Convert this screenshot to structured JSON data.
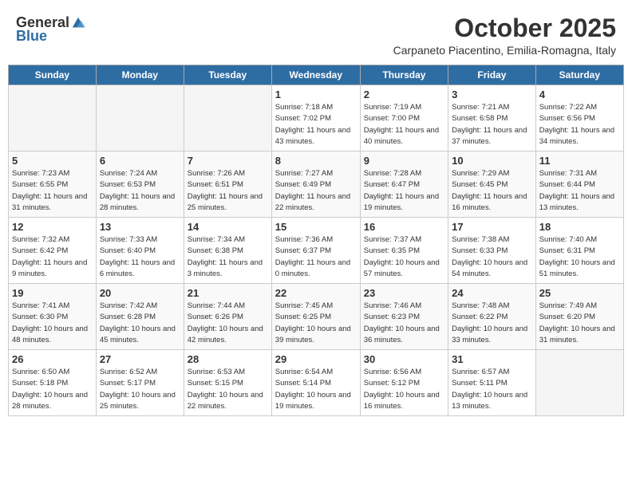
{
  "header": {
    "logo_general": "General",
    "logo_blue": "Blue",
    "month_title": "October 2025",
    "subtitle": "Carpaneto Piacentino, Emilia-Romagna, Italy"
  },
  "days_of_week": [
    "Sunday",
    "Monday",
    "Tuesday",
    "Wednesday",
    "Thursday",
    "Friday",
    "Saturday"
  ],
  "weeks": [
    [
      {
        "day": "",
        "info": ""
      },
      {
        "day": "",
        "info": ""
      },
      {
        "day": "",
        "info": ""
      },
      {
        "day": "1",
        "info": "Sunrise: 7:18 AM\nSunset: 7:02 PM\nDaylight: 11 hours and 43 minutes."
      },
      {
        "day": "2",
        "info": "Sunrise: 7:19 AM\nSunset: 7:00 PM\nDaylight: 11 hours and 40 minutes."
      },
      {
        "day": "3",
        "info": "Sunrise: 7:21 AM\nSunset: 6:58 PM\nDaylight: 11 hours and 37 minutes."
      },
      {
        "day": "4",
        "info": "Sunrise: 7:22 AM\nSunset: 6:56 PM\nDaylight: 11 hours and 34 minutes."
      }
    ],
    [
      {
        "day": "5",
        "info": "Sunrise: 7:23 AM\nSunset: 6:55 PM\nDaylight: 11 hours and 31 minutes."
      },
      {
        "day": "6",
        "info": "Sunrise: 7:24 AM\nSunset: 6:53 PM\nDaylight: 11 hours and 28 minutes."
      },
      {
        "day": "7",
        "info": "Sunrise: 7:26 AM\nSunset: 6:51 PM\nDaylight: 11 hours and 25 minutes."
      },
      {
        "day": "8",
        "info": "Sunrise: 7:27 AM\nSunset: 6:49 PM\nDaylight: 11 hours and 22 minutes."
      },
      {
        "day": "9",
        "info": "Sunrise: 7:28 AM\nSunset: 6:47 PM\nDaylight: 11 hours and 19 minutes."
      },
      {
        "day": "10",
        "info": "Sunrise: 7:29 AM\nSunset: 6:45 PM\nDaylight: 11 hours and 16 minutes."
      },
      {
        "day": "11",
        "info": "Sunrise: 7:31 AM\nSunset: 6:44 PM\nDaylight: 11 hours and 13 minutes."
      }
    ],
    [
      {
        "day": "12",
        "info": "Sunrise: 7:32 AM\nSunset: 6:42 PM\nDaylight: 11 hours and 9 minutes."
      },
      {
        "day": "13",
        "info": "Sunrise: 7:33 AM\nSunset: 6:40 PM\nDaylight: 11 hours and 6 minutes."
      },
      {
        "day": "14",
        "info": "Sunrise: 7:34 AM\nSunset: 6:38 PM\nDaylight: 11 hours and 3 minutes."
      },
      {
        "day": "15",
        "info": "Sunrise: 7:36 AM\nSunset: 6:37 PM\nDaylight: 11 hours and 0 minutes."
      },
      {
        "day": "16",
        "info": "Sunrise: 7:37 AM\nSunset: 6:35 PM\nDaylight: 10 hours and 57 minutes."
      },
      {
        "day": "17",
        "info": "Sunrise: 7:38 AM\nSunset: 6:33 PM\nDaylight: 10 hours and 54 minutes."
      },
      {
        "day": "18",
        "info": "Sunrise: 7:40 AM\nSunset: 6:31 PM\nDaylight: 10 hours and 51 minutes."
      }
    ],
    [
      {
        "day": "19",
        "info": "Sunrise: 7:41 AM\nSunset: 6:30 PM\nDaylight: 10 hours and 48 minutes."
      },
      {
        "day": "20",
        "info": "Sunrise: 7:42 AM\nSunset: 6:28 PM\nDaylight: 10 hours and 45 minutes."
      },
      {
        "day": "21",
        "info": "Sunrise: 7:44 AM\nSunset: 6:26 PM\nDaylight: 10 hours and 42 minutes."
      },
      {
        "day": "22",
        "info": "Sunrise: 7:45 AM\nSunset: 6:25 PM\nDaylight: 10 hours and 39 minutes."
      },
      {
        "day": "23",
        "info": "Sunrise: 7:46 AM\nSunset: 6:23 PM\nDaylight: 10 hours and 36 minutes."
      },
      {
        "day": "24",
        "info": "Sunrise: 7:48 AM\nSunset: 6:22 PM\nDaylight: 10 hours and 33 minutes."
      },
      {
        "day": "25",
        "info": "Sunrise: 7:49 AM\nSunset: 6:20 PM\nDaylight: 10 hours and 31 minutes."
      }
    ],
    [
      {
        "day": "26",
        "info": "Sunrise: 6:50 AM\nSunset: 5:18 PM\nDaylight: 10 hours and 28 minutes."
      },
      {
        "day": "27",
        "info": "Sunrise: 6:52 AM\nSunset: 5:17 PM\nDaylight: 10 hours and 25 minutes."
      },
      {
        "day": "28",
        "info": "Sunrise: 6:53 AM\nSunset: 5:15 PM\nDaylight: 10 hours and 22 minutes."
      },
      {
        "day": "29",
        "info": "Sunrise: 6:54 AM\nSunset: 5:14 PM\nDaylight: 10 hours and 19 minutes."
      },
      {
        "day": "30",
        "info": "Sunrise: 6:56 AM\nSunset: 5:12 PM\nDaylight: 10 hours and 16 minutes."
      },
      {
        "day": "31",
        "info": "Sunrise: 6:57 AM\nSunset: 5:11 PM\nDaylight: 10 hours and 13 minutes."
      },
      {
        "day": "",
        "info": ""
      }
    ]
  ]
}
